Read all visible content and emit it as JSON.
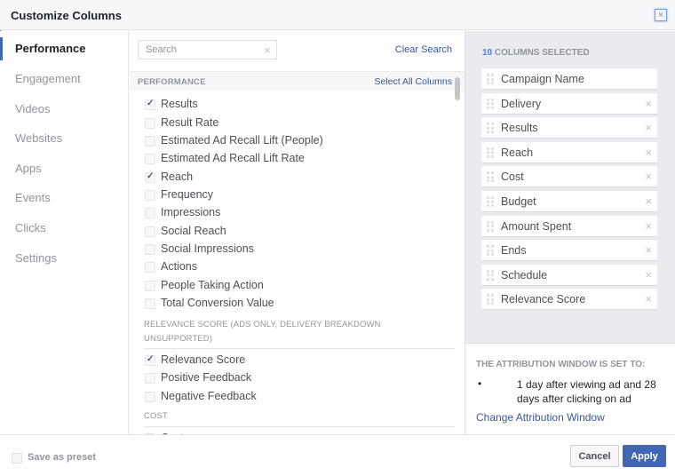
{
  "dialog": {
    "title": "Customize Columns",
    "close_icon": "close-icon"
  },
  "sidebar": {
    "items": [
      {
        "label": "Performance",
        "active": true
      },
      {
        "label": "Engagement",
        "active": false
      },
      {
        "label": "Videos",
        "active": false
      },
      {
        "label": "Websites",
        "active": false
      },
      {
        "label": "Apps",
        "active": false
      },
      {
        "label": "Events",
        "active": false
      },
      {
        "label": "Clicks",
        "active": false
      },
      {
        "label": "Settings",
        "active": false
      }
    ]
  },
  "search": {
    "placeholder": "Search",
    "value": "",
    "clear_icon": "×",
    "clear_search_label": "Clear Search"
  },
  "performance_section": {
    "header": "PERFORMANCE",
    "select_all_label": "Select All Columns",
    "items": [
      {
        "label": "Results",
        "checked": true
      },
      {
        "label": "Result Rate",
        "checked": false
      },
      {
        "label": "Estimated Ad Recall Lift (People)",
        "checked": false
      },
      {
        "label": "Estimated Ad Recall Lift Rate",
        "checked": false
      },
      {
        "label": "Reach",
        "checked": true
      },
      {
        "label": "Frequency",
        "checked": false
      },
      {
        "label": "Impressions",
        "checked": false
      },
      {
        "label": "Social Reach",
        "checked": false
      },
      {
        "label": "Social Impressions",
        "checked": false
      },
      {
        "label": "Actions",
        "checked": false
      },
      {
        "label": "People Taking Action",
        "checked": false
      },
      {
        "label": "Total Conversion Value",
        "checked": false
      }
    ]
  },
  "relevance_section": {
    "header": "RELEVANCE SCORE (ADS ONLY, DELIVERY BREAKDOWN UNSUPPORTED)",
    "items": [
      {
        "label": "Relevance Score",
        "checked": true
      },
      {
        "label": "Positive Feedback",
        "checked": false
      },
      {
        "label": "Negative Feedback",
        "checked": false
      }
    ]
  },
  "cost_section": {
    "header": "COST",
    "items": [
      {
        "label": "Cost",
        "checked": false
      }
    ]
  },
  "selected_columns": {
    "count": "10",
    "label": "COLUMNS SELECTED",
    "items": [
      {
        "label": "Campaign Name",
        "removable": false
      },
      {
        "label": "Delivery",
        "removable": true
      },
      {
        "label": "Results",
        "removable": true
      },
      {
        "label": "Reach",
        "removable": true
      },
      {
        "label": "Cost",
        "removable": true
      },
      {
        "label": "Budget",
        "removable": true
      },
      {
        "label": "Amount Spent",
        "removable": true
      },
      {
        "label": "Ends",
        "removable": true
      },
      {
        "label": "Schedule",
        "removable": true
      },
      {
        "label": "Relevance Score",
        "removable": true
      }
    ],
    "remove_icon": "×"
  },
  "attribution": {
    "title": "THE ATTRIBUTION WINDOW IS SET TO:",
    "bullet": "•",
    "text": "1 day after viewing ad and 28 days after clicking on ad",
    "link": "Change Attribution Window"
  },
  "footer": {
    "save_preset_label": "Save as preset",
    "save_preset_checked": false,
    "cancel_label": "Cancel",
    "apply_label": "Apply"
  },
  "colors": {
    "accent": "#4267b2",
    "link": "#365899",
    "count": "#4080ff"
  }
}
